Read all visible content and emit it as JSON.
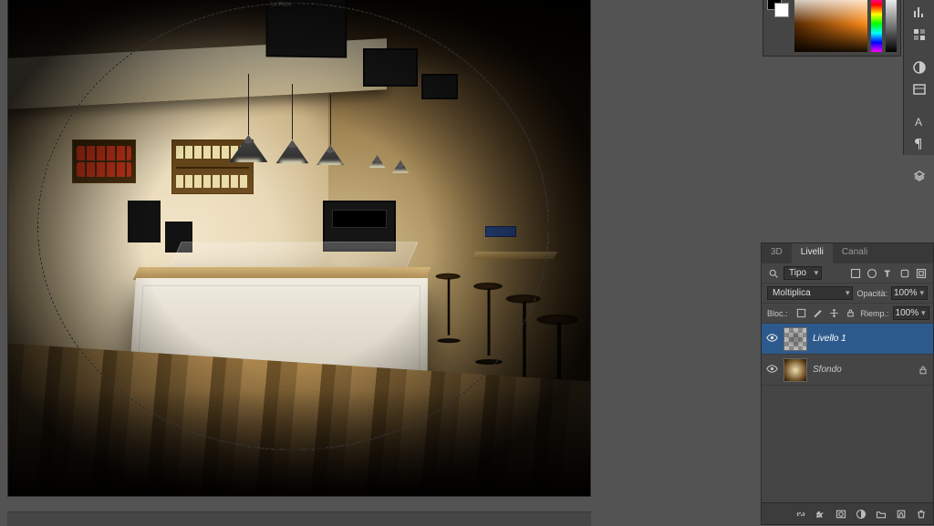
{
  "menu_boards": {
    "b1_line1": "Le Pizze",
    "b1_line2": "",
    "b1_line3": "",
    "b2": "",
    "b3": ""
  },
  "wall_sign": "",
  "right_dock": {
    "i1": "histogram-icon",
    "i2": "swatches-icon",
    "i3": "adjustments-icon",
    "i4": "layers-comp-icon",
    "i5": "character-icon",
    "i6": "paragraph-icon",
    "i7": "properties-icon"
  },
  "layers_panel": {
    "tabs": {
      "t3d": "3D",
      "layers": "Livelli",
      "channels": "Canali"
    },
    "filter_label": "Tipo",
    "blend_mode": "Moltiplica",
    "opacity_label": "Opacità:",
    "opacity_value": "100%",
    "lock_label": "Bloc.:",
    "fill_label": "Riemp.:",
    "fill_value": "100%",
    "layers": [
      {
        "name": "Livello 1",
        "selected": true,
        "locked": false,
        "thumb": "checker"
      },
      {
        "name": "Sfondo",
        "selected": false,
        "locked": true,
        "thumb": "photo"
      }
    ],
    "search_icon": "search-icon"
  }
}
